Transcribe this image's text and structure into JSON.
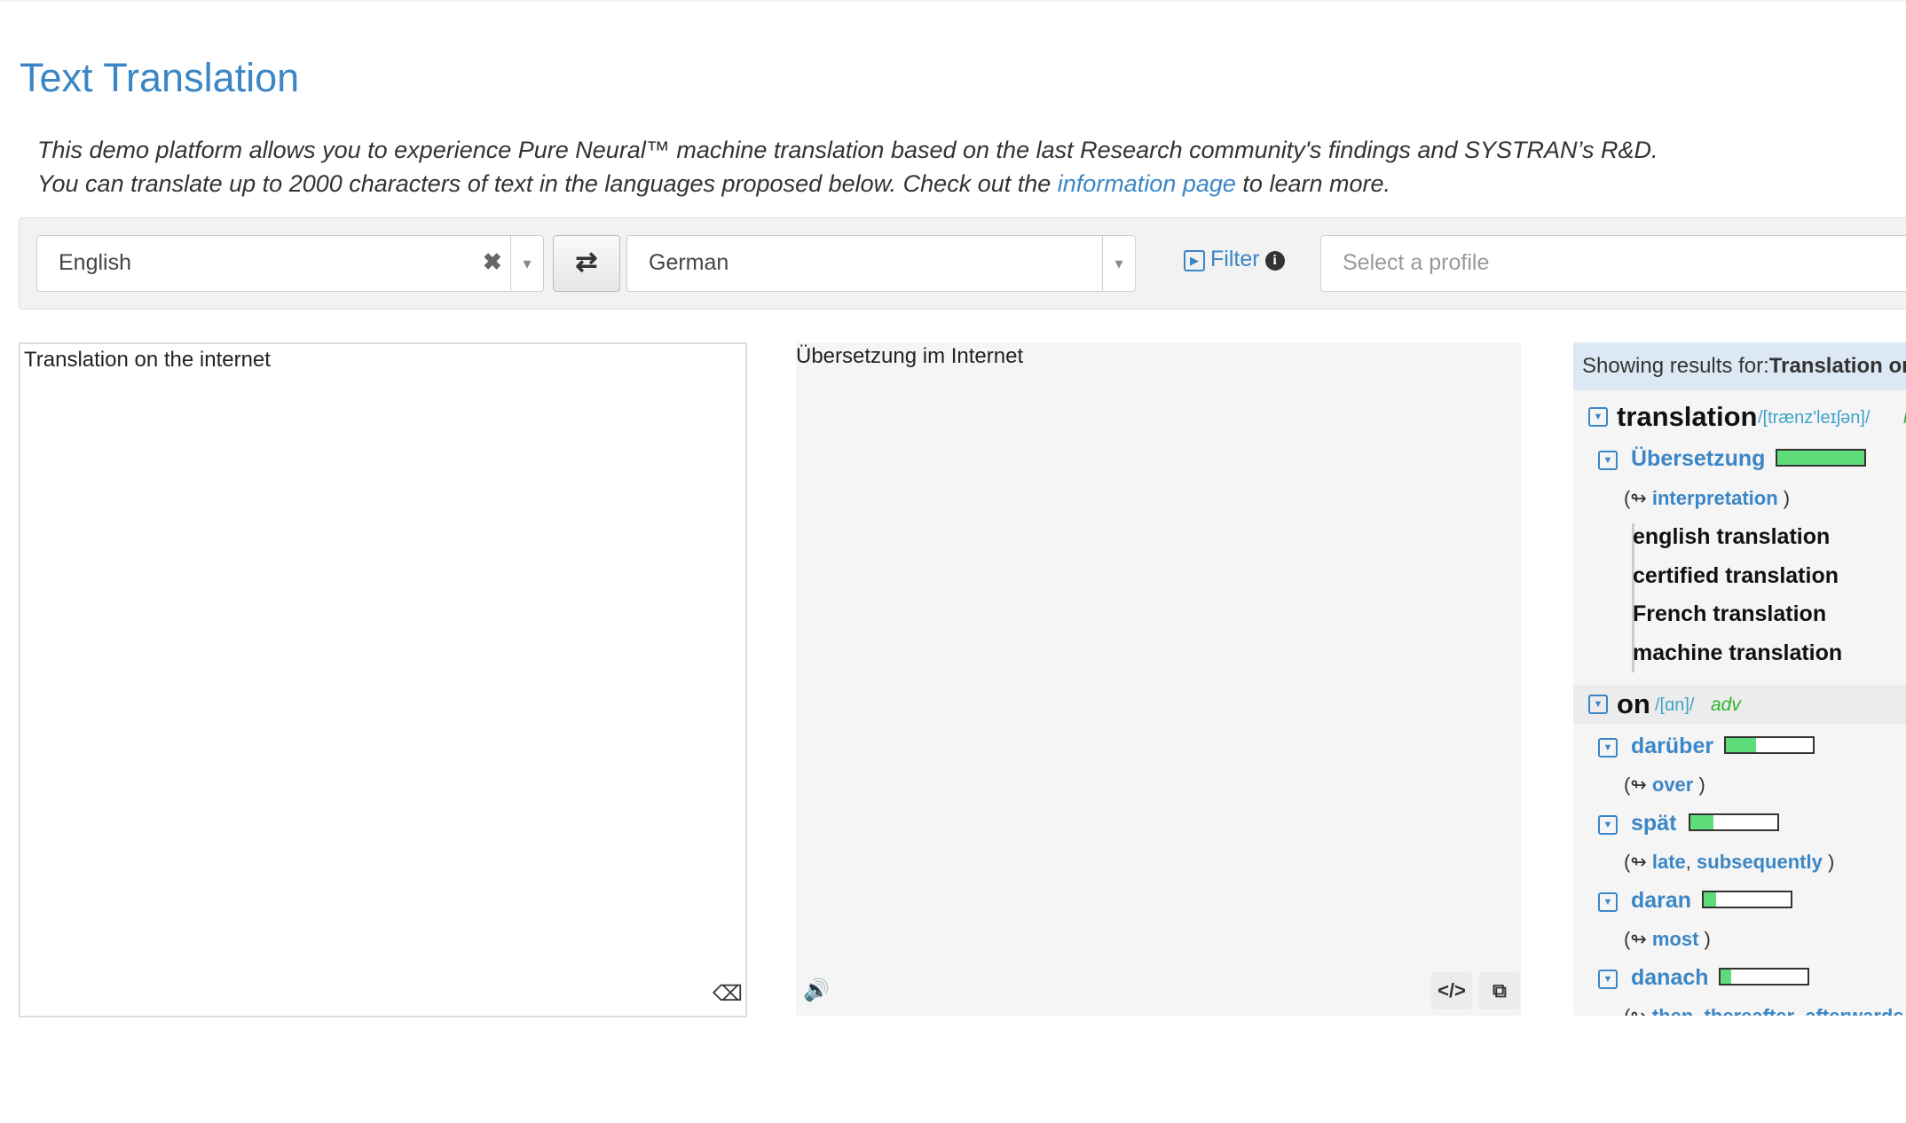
{
  "header": {
    "title": "Text Translation",
    "desc_line1": "This demo platform allows you to experience Pure Neural™ machine translation based on the last Research community's findings and SYSTRAN’s R&D.",
    "desc_line2_pre": "You can translate up to 2000 characters of text in the languages proposed below. Check out the ",
    "desc_link": "information page",
    "desc_line2_post": " to learn more."
  },
  "toolbar": {
    "source_lang": "English",
    "target_lang": "German",
    "clear_glyph": "✖",
    "dropdown_glyph": "▾",
    "swap_glyph": "⇄",
    "filter_label": "Filter",
    "profile_placeholder": "Select a profile"
  },
  "source": {
    "text": "Translation on the internet",
    "eraser_glyph": "⌫"
  },
  "target": {
    "text": "Übersetzung im Internet",
    "speaker_glyph": "🔊",
    "code_glyph": "</>",
    "copy_glyph": "⧉"
  },
  "dictionary": {
    "header_label": "Showing results for:",
    "header_query": "Translation on the internet",
    "entries": [
      {
        "word": "translation",
        "pron": "/[trænz'leɪʃən]/",
        "pos": "n",
        "translations": [
          {
            "word": "Übersetzung",
            "freq": 1.0,
            "back": [
              "interpretation"
            ],
            "examples": [
              "english translation",
              "certified translation",
              "French translation",
              "machine translation"
            ]
          }
        ]
      },
      {
        "word": "on",
        "pron": "/[ɑn]/",
        "pos": "adv",
        "translations": [
          {
            "word": "darüber",
            "freq": 0.35,
            "back": [
              "over"
            ]
          },
          {
            "word": "spät",
            "freq": 0.27,
            "back": [
              "late",
              "subsequently"
            ]
          },
          {
            "word": "daran",
            "freq": 0.14,
            "back": [
              "most"
            ]
          },
          {
            "word": "danach",
            "freq": 0.12,
            "back": [
              "then",
              "thereafter",
              "afterwards"
            ]
          }
        ]
      }
    ]
  },
  "colors": {
    "accent": "#3b86c6",
    "freq_fill": "#5fdc7a",
    "pos": "#2db42d"
  }
}
